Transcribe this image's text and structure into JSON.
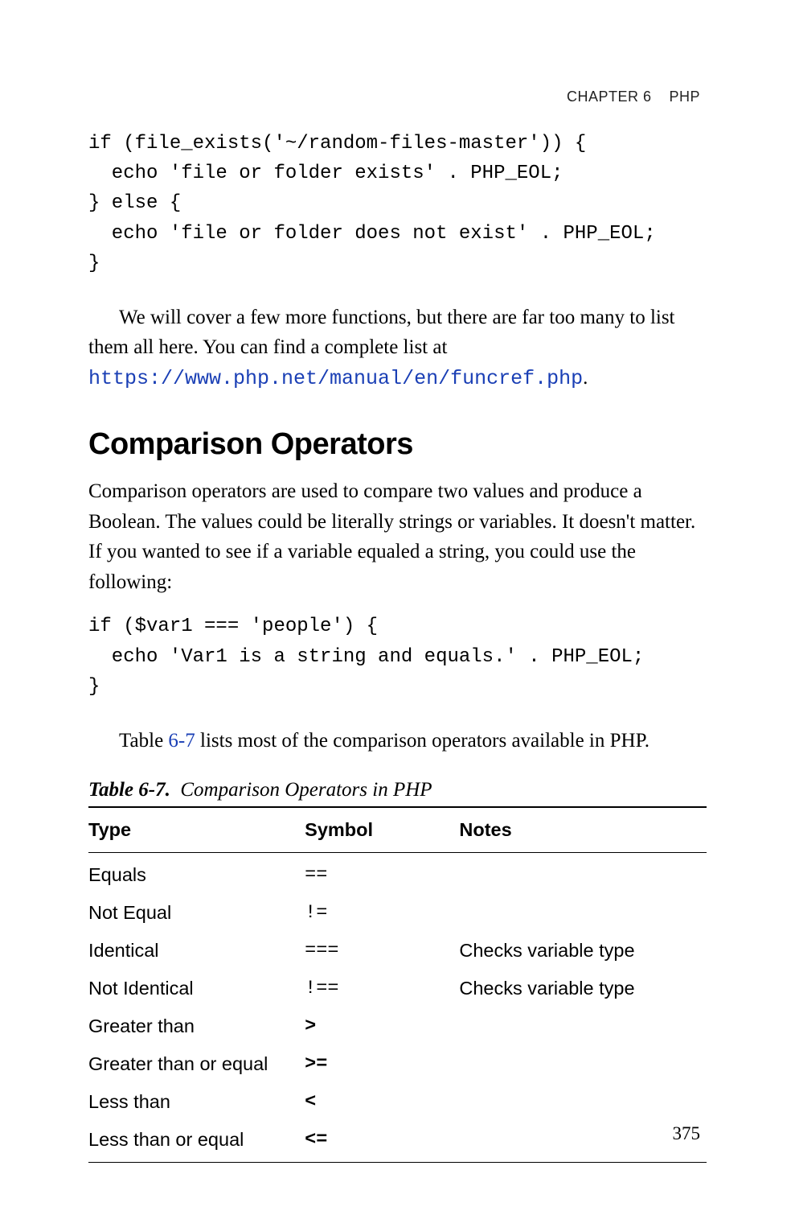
{
  "header": {
    "chapter": "CHAPTER 6",
    "subject": "PHP"
  },
  "code1": "if (file_exists('~/random-files-master')) {\n  echo 'file or folder exists' . PHP_EOL;\n} else {\n  echo 'file or folder does not exist' . PHP_EOL;\n}",
  "para1_a": "We will cover a few more functions, but there are far too many to list them all here. You can find a complete list at ",
  "link1": "https://www.php.net/manual/en/funcref.php",
  "para1_b": ".",
  "heading": "Comparison Operators",
  "para2": "Comparison operators are used to compare two values and produce a Boolean. The values could be literally strings or variables. It doesn't matter. If you wanted to see if a variable equaled a string, you could use the following:",
  "code2": "if ($var1 === 'people') {\n  echo 'Var1 is a string and equals.' . PHP_EOL;\n}",
  "para3_a": "Table ",
  "xref": "6-7",
  "para3_b": " lists most of the comparison operators available in PHP.",
  "table": {
    "label": "Table 6-7.",
    "title": "Comparison Operators in PHP",
    "headers": {
      "c1": "Type",
      "c2": "Symbol",
      "c3": "Notes"
    },
    "rows": [
      {
        "type": "Equals",
        "symbol": "==",
        "notes": "",
        "bold": false
      },
      {
        "type": "Not Equal",
        "symbol": "!=",
        "notes": "",
        "bold": false
      },
      {
        "type": "Identical",
        "symbol": "===",
        "notes": "Checks variable type",
        "bold": false
      },
      {
        "type": "Not Identical",
        "symbol": "!==",
        "notes": "Checks variable type",
        "bold": false
      },
      {
        "type": "Greater than",
        "symbol": ">",
        "notes": "",
        "bold": true
      },
      {
        "type": "Greater than or equal",
        "symbol": ">=",
        "notes": "",
        "bold": true
      },
      {
        "type": "Less than",
        "symbol": "<",
        "notes": "",
        "bold": true
      },
      {
        "type": "Less than or equal",
        "symbol": "<=",
        "notes": "",
        "bold": true
      }
    ]
  },
  "page_number": "375"
}
